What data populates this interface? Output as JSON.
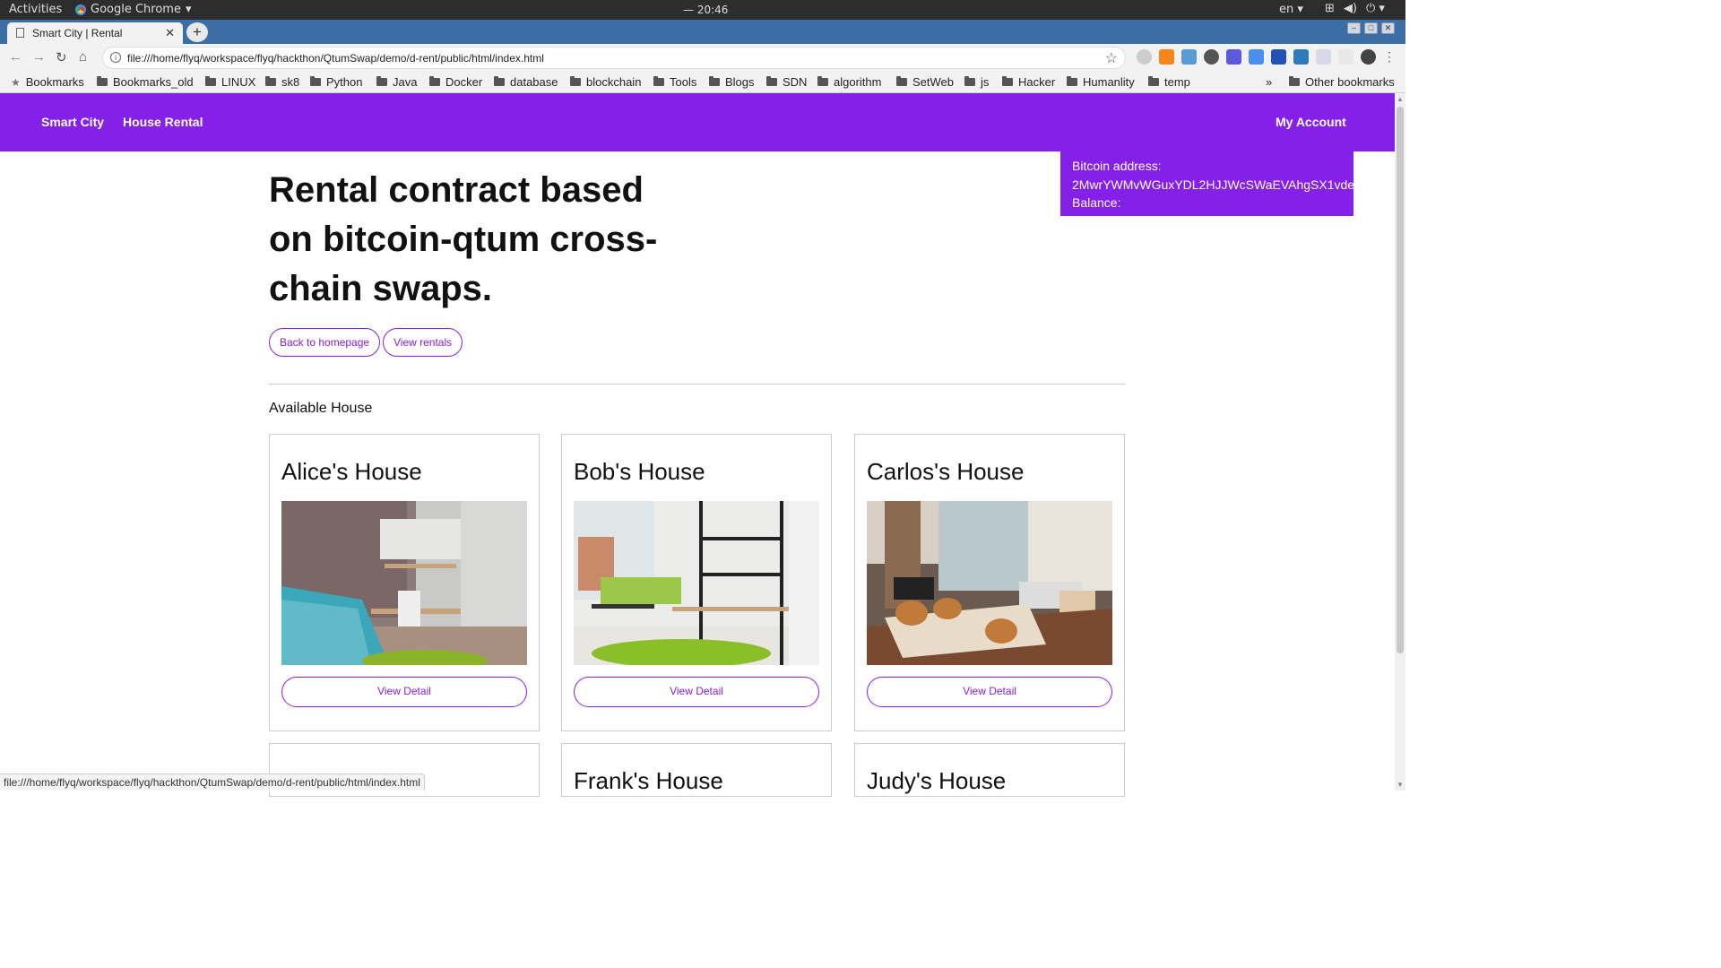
{
  "system": {
    "activities": "Activities",
    "app_name": "Google Chrome",
    "clock": "— 20:46",
    "lang": "en"
  },
  "browser": {
    "tab_title": "Smart City | Rental",
    "url": "file:///home/flyq/workspace/flyq/hackthon/QtumSwap/demo/d-rent/public/html/index.html",
    "bookmarks": [
      "Bookmarks",
      "Bookmarks_old",
      "LINUX",
      "sk8",
      "Python",
      "Java",
      "Docker",
      "database",
      "blockchain",
      "Tools",
      "Blogs",
      "SDN",
      "algorithm",
      "SetWeb",
      "js",
      "Hacker",
      "Humanlity",
      "temp"
    ],
    "overflow": "»",
    "other_bookmarks": "Other bookmarks",
    "status_url": "file:///home/flyq/workspace/flyq/hackthon/QtumSwap/demo/d-rent/public/html/index.html"
  },
  "nav": {
    "brand": "Smart City",
    "link": "House Rental",
    "account": "My Account"
  },
  "account": {
    "address_label": "Bitcoin address:",
    "address": "2MwrYWMvWGuxYDL2HJJWcSWaEVAhgSX1vde",
    "balance_label": "Balance:"
  },
  "hero": {
    "title": "Rental contract based on bitcoin-qtum cross-chain swaps.",
    "btn_home": "Back to homepage",
    "btn_rentals": "View rentals"
  },
  "section": {
    "title": "Available House"
  },
  "houses": [
    {
      "name": "Alice's House",
      "button": "View Detail"
    },
    {
      "name": "Bob's House",
      "button": "View Detail"
    },
    {
      "name": "Carlos's House",
      "button": "View Detail"
    },
    {
      "name": "Frank's House"
    },
    {
      "name": "Judy's House"
    }
  ],
  "colors": {
    "accent": "#8420e8"
  }
}
